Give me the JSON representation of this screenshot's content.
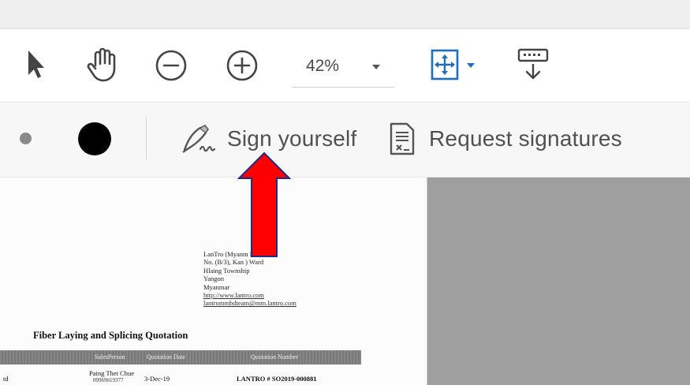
{
  "toolbar": {
    "tools": [
      {
        "name": "select-arrow-icon"
      },
      {
        "name": "hand-icon"
      },
      {
        "name": "zoom-out-icon"
      },
      {
        "name": "zoom-in-icon"
      }
    ],
    "zoom": "42%",
    "fit_icon": "fit-page-icon",
    "scroll_icon": "scroll-mode-icon"
  },
  "sign": {
    "sign_yourself": "Sign yourself",
    "request_signatures": "Request signatures",
    "colors": {
      "small_dot": "#8a8a8a",
      "big_dot": "#000000"
    }
  },
  "document": {
    "address": [
      "LanTro (Myanm     Ltd",
      "No. (B/3), Kan      ) Ward",
      "Hlaing Township",
      "Yangon",
      "Myanmar"
    ],
    "links": [
      "http://www.lantro.com",
      "lantrommbdteam@mm.lantro.com"
    ],
    "title": "Fiber Laying and Splicing Quotation",
    "table_headers": [
      "SalesPerson",
      "Quotation Date",
      "Quotation Number"
    ],
    "row": {
      "left": "td",
      "salesperson": "Paing Thet Chue",
      "phone": "09969619377",
      "date": "3-Dec-19",
      "number": "LANTRO # SO2019-000881"
    }
  },
  "annotation": {
    "arrow_color": "#ff0000"
  }
}
